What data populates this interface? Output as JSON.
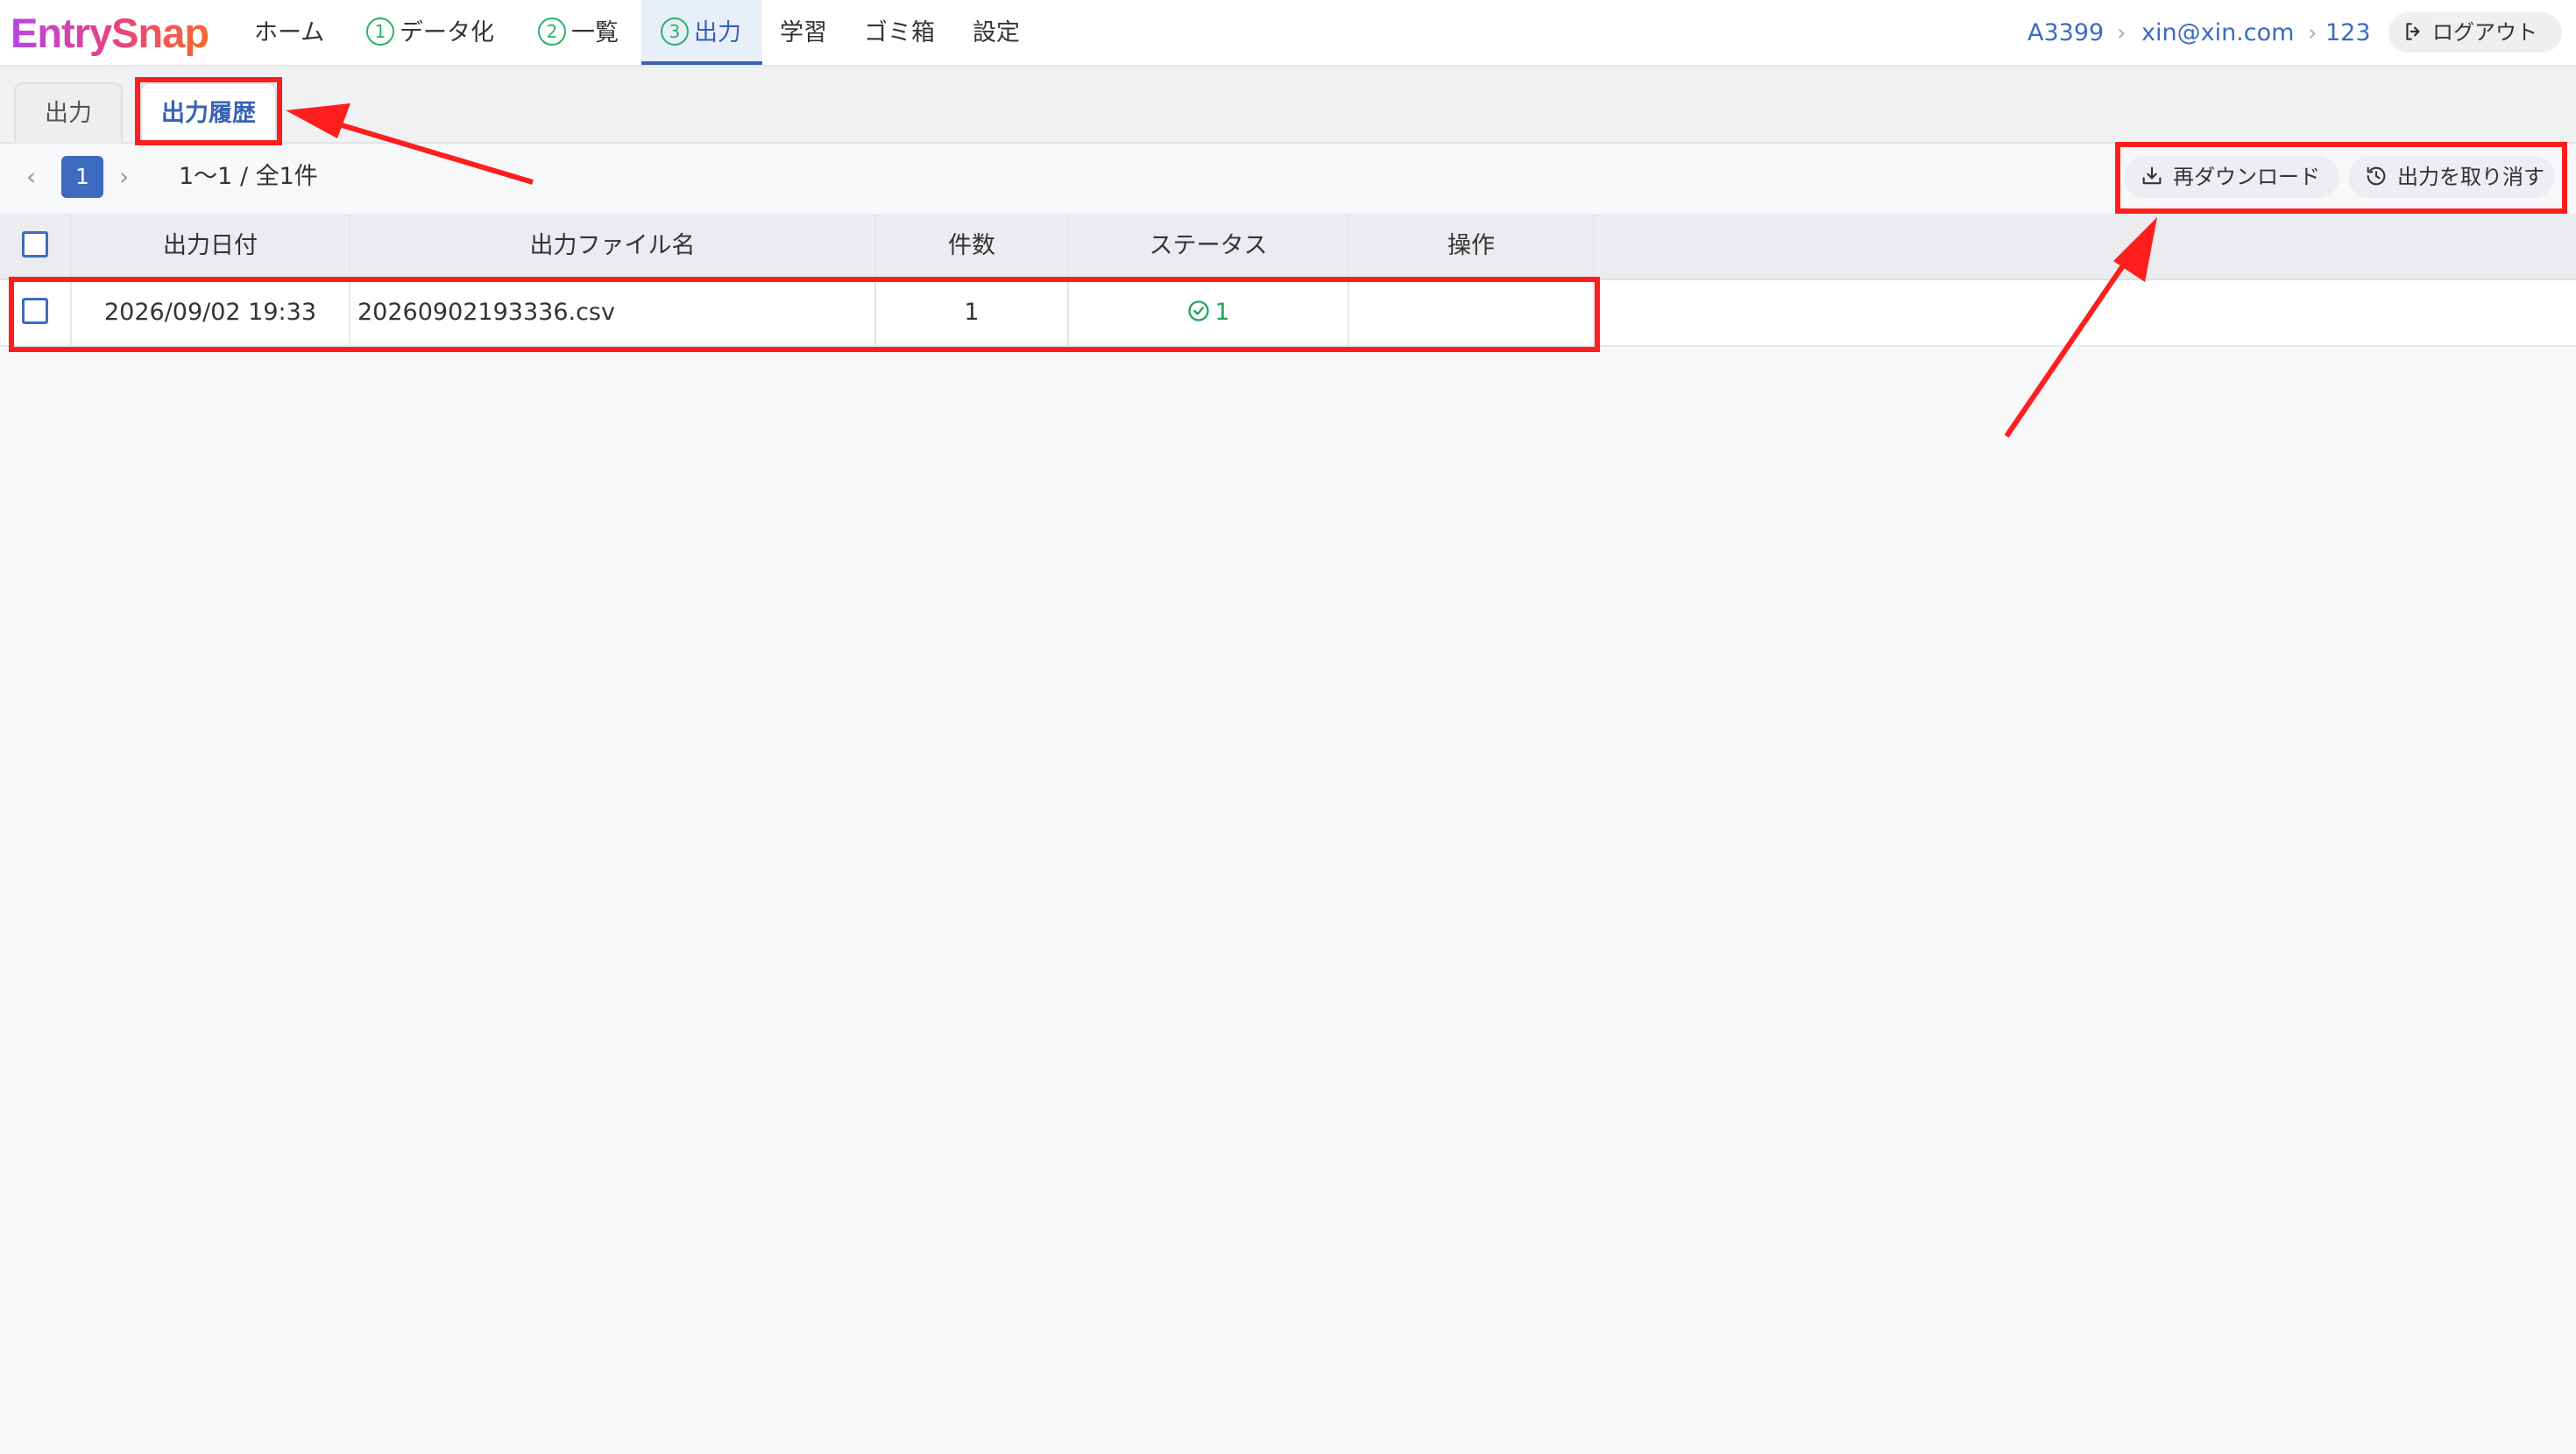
{
  "app": {
    "logo": "EntrySnap"
  },
  "nav": {
    "home": "ホーム",
    "digitize": {
      "num": "1",
      "label": "データ化"
    },
    "list": {
      "num": "2",
      "label": "一覧"
    },
    "output": {
      "num": "3",
      "label": "出力"
    },
    "learn": "学習",
    "trash": "ゴミ箱",
    "settings": "設定"
  },
  "breadcrumb": {
    "account": "A3399",
    "email": "xin@xin.com",
    "user": "123"
  },
  "logout_label": "ログアウト",
  "tabs": {
    "output": "出力",
    "history": "出力履歴"
  },
  "pager": {
    "current_page": "1",
    "info": "1〜1 / 全1件"
  },
  "actions": {
    "redownload": "再ダウンロード",
    "cancel_output": "出力を取り消す"
  },
  "table": {
    "columns": [
      "出力日付",
      "出力ファイル名",
      "件数",
      "ステータス",
      "操作"
    ],
    "rows": [
      {
        "date": "2026/09/02 19:33",
        "filename": "20260902193336.csv",
        "count": "1",
        "status": "1",
        "operation": ""
      }
    ]
  },
  "colors": {
    "accent": "#3862b6",
    "success": "#22a35a",
    "annotation": "#ff1e1e"
  },
  "icons": [
    "download-tray-icon",
    "history-icon",
    "logout-icon",
    "check-circle-icon",
    "chevron-left-icon",
    "chevron-right-icon"
  ]
}
